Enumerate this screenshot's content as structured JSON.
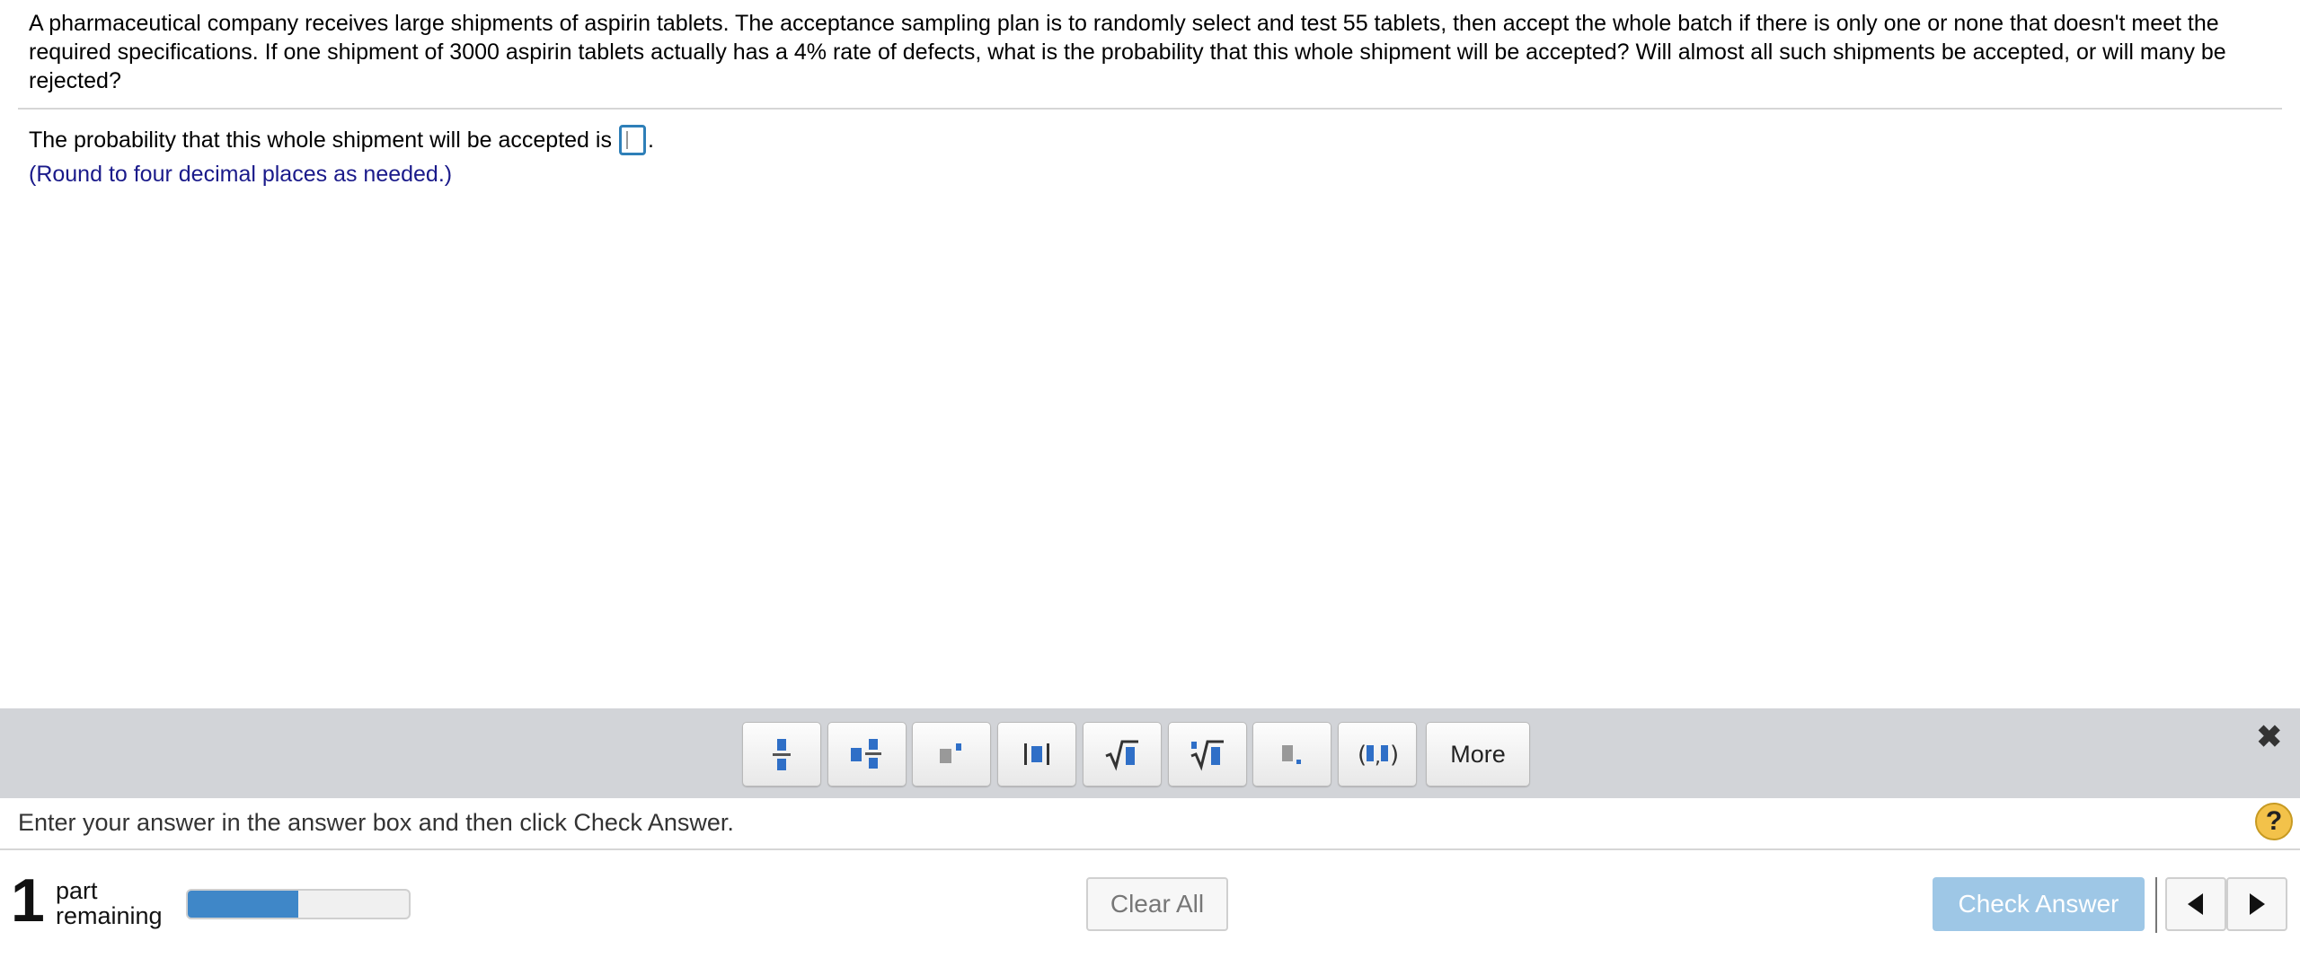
{
  "question": {
    "text": "A pharmaceutical company receives large shipments of aspirin tablets. The acceptance sampling plan is to randomly select and test 55 tablets, then accept the whole batch if there is only one or none that doesn't meet the required specifications. If one shipment of 3000 aspirin tablets actually has a 4% rate of defects, what is the probability that this whole shipment will be accepted? Will almost all such shipments be accepted, or will many be rejected?"
  },
  "answer": {
    "prompt": "The probability that this whole shipment will be accepted is",
    "value": "",
    "suffix": ".",
    "hint": "(Round to four decimal places as needed.)"
  },
  "toolbar": {
    "buttons": [
      {
        "icon": "fraction-icon"
      },
      {
        "icon": "mixed-number-icon"
      },
      {
        "icon": "exponent-icon"
      },
      {
        "icon": "absolute-value-icon"
      },
      {
        "icon": "square-root-icon"
      },
      {
        "icon": "nth-root-icon"
      },
      {
        "icon": "decimal-icon"
      },
      {
        "icon": "ordered-pair-icon"
      }
    ],
    "more_label": "More",
    "close_icon": "close-icon"
  },
  "instruction": {
    "text": "Enter your answer in the answer box and then click Check Answer.",
    "help_label": "?"
  },
  "footer": {
    "parts_remaining": "1",
    "parts_label_line1": "part",
    "parts_label_line2": "remaining",
    "progress_fraction": 0.5,
    "clear_all_label": "Clear All",
    "check_answer_label": "Check Answer"
  },
  "colors": {
    "accent_blue": "#3f87c8",
    "check_button_disabled": "#9ec7e6",
    "hint_text": "#1a1a8a",
    "toolbar_bg": "#d2d4d8"
  }
}
